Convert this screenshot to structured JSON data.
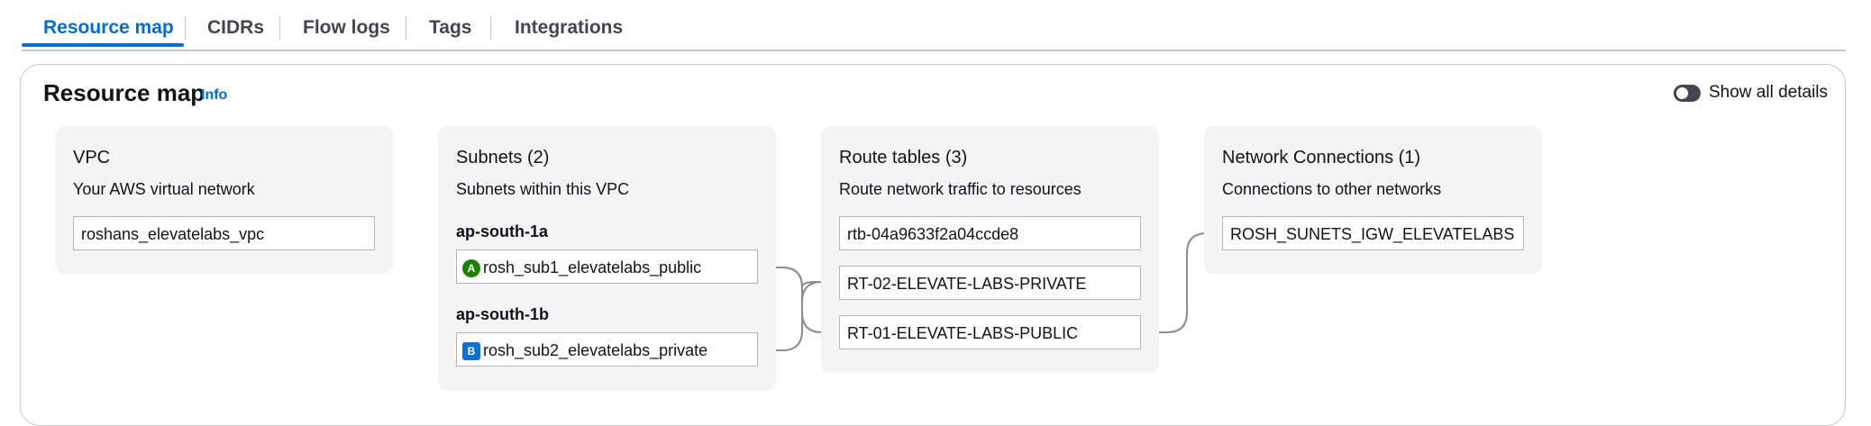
{
  "tabs": [
    {
      "label": "Resource map",
      "active": true
    },
    {
      "label": "CIDRs",
      "active": false
    },
    {
      "label": "Flow logs",
      "active": false
    },
    {
      "label": "Tags",
      "active": false
    },
    {
      "label": "Integrations",
      "active": false
    }
  ],
  "header": {
    "title": "Resource map",
    "info": "Info",
    "toggle_label": "Show all details"
  },
  "vpc": {
    "title": "VPC",
    "subtitle": "Your AWS virtual network",
    "name": "roshans_elevatelabs_vpc"
  },
  "subnets": {
    "title": "Subnets (2)",
    "subtitle": "Subnets within this VPC",
    "groups": [
      {
        "az": "ap-south-1a",
        "badge": "A",
        "subnet": "rosh_sub1_elevatelabs_public"
      },
      {
        "az": "ap-south-1b",
        "badge": "B",
        "subnet": "rosh_sub2_elevatelabs_private"
      }
    ]
  },
  "route_tables": {
    "title": "Route tables (3)",
    "subtitle": "Route network traffic to resources",
    "items": [
      "rtb-04a9633f2a04ccde8",
      "RT-02-ELEVATE-LABS-PRIVATE",
      "RT-01-ELEVATE-LABS-PUBLIC"
    ]
  },
  "network_connections": {
    "title": "Network Connections (1)",
    "subtitle": "Connections to other networks",
    "items": [
      "ROSH_SUNETS_IGW_ELEVATELABS"
    ]
  },
  "colors": {
    "accent": "#006ce0",
    "az_a": "#1d8102",
    "az_b": "#0972d3",
    "connector": "#8c8c94"
  }
}
